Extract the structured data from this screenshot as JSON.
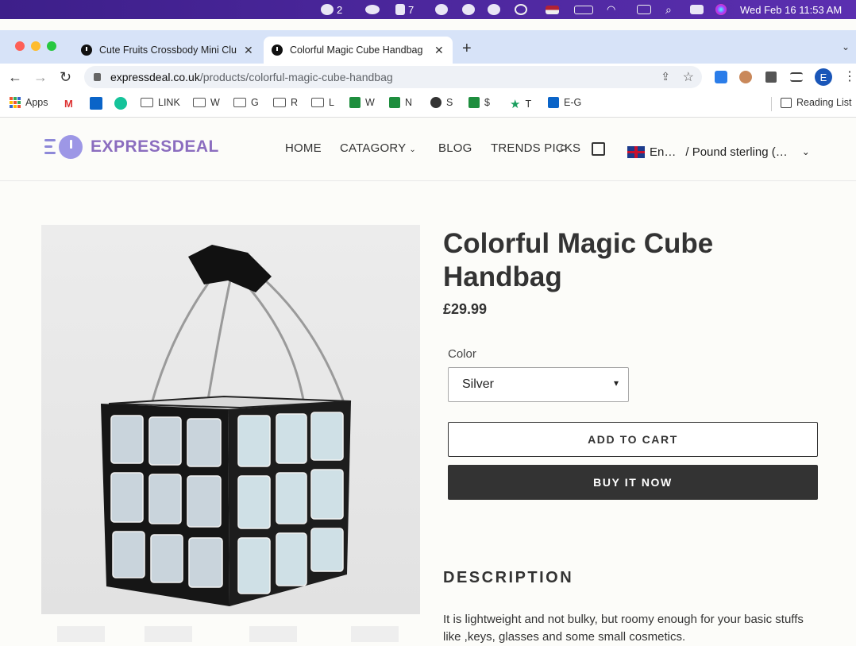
{
  "system_bar": {
    "wechat_count": "2",
    "qq_count": "7",
    "datetime": "Wed Feb 16  11:53 AM"
  },
  "browser": {
    "tabs": [
      {
        "title": "Cute Fruits Crossbody Mini Clu",
        "active": false
      },
      {
        "title": "Colorful Magic Cube Handbag",
        "active": true
      }
    ],
    "url_host": "expressdeal.co.uk",
    "url_path": "/products/colorful-magic-cube-handbag",
    "profile_initial": "E",
    "bookmarks": [
      "Apps",
      "LINK",
      "W",
      "G",
      "R",
      "L",
      "W",
      "N",
      "S",
      "$",
      "T",
      "E-G"
    ],
    "reading_list": "Reading List"
  },
  "site": {
    "logo_text": "EXPRESSDEAL",
    "nav": [
      "HOME",
      "CATAGORY",
      "BLOG",
      "TRENDS PICKS"
    ],
    "currency": {
      "language": "En…",
      "currency": "/ Pound sterling (…"
    }
  },
  "product": {
    "title": "Colorful Magic Cube Handbag",
    "price": "£29.99",
    "color_label": "Color",
    "color_value": "Silver",
    "add_to_cart": "ADD TO CART",
    "buy_now": "BUY IT NOW",
    "description_heading": "DESCRIPTION",
    "description_text": "It is lightweight and not bulky, but roomy enough for your basic stuffs like ,keys, glasses and some small cosmetics."
  },
  "colors": {
    "accent": "#8b6dbf",
    "button_dark": "#333333",
    "menubar": "#4a28a0"
  }
}
